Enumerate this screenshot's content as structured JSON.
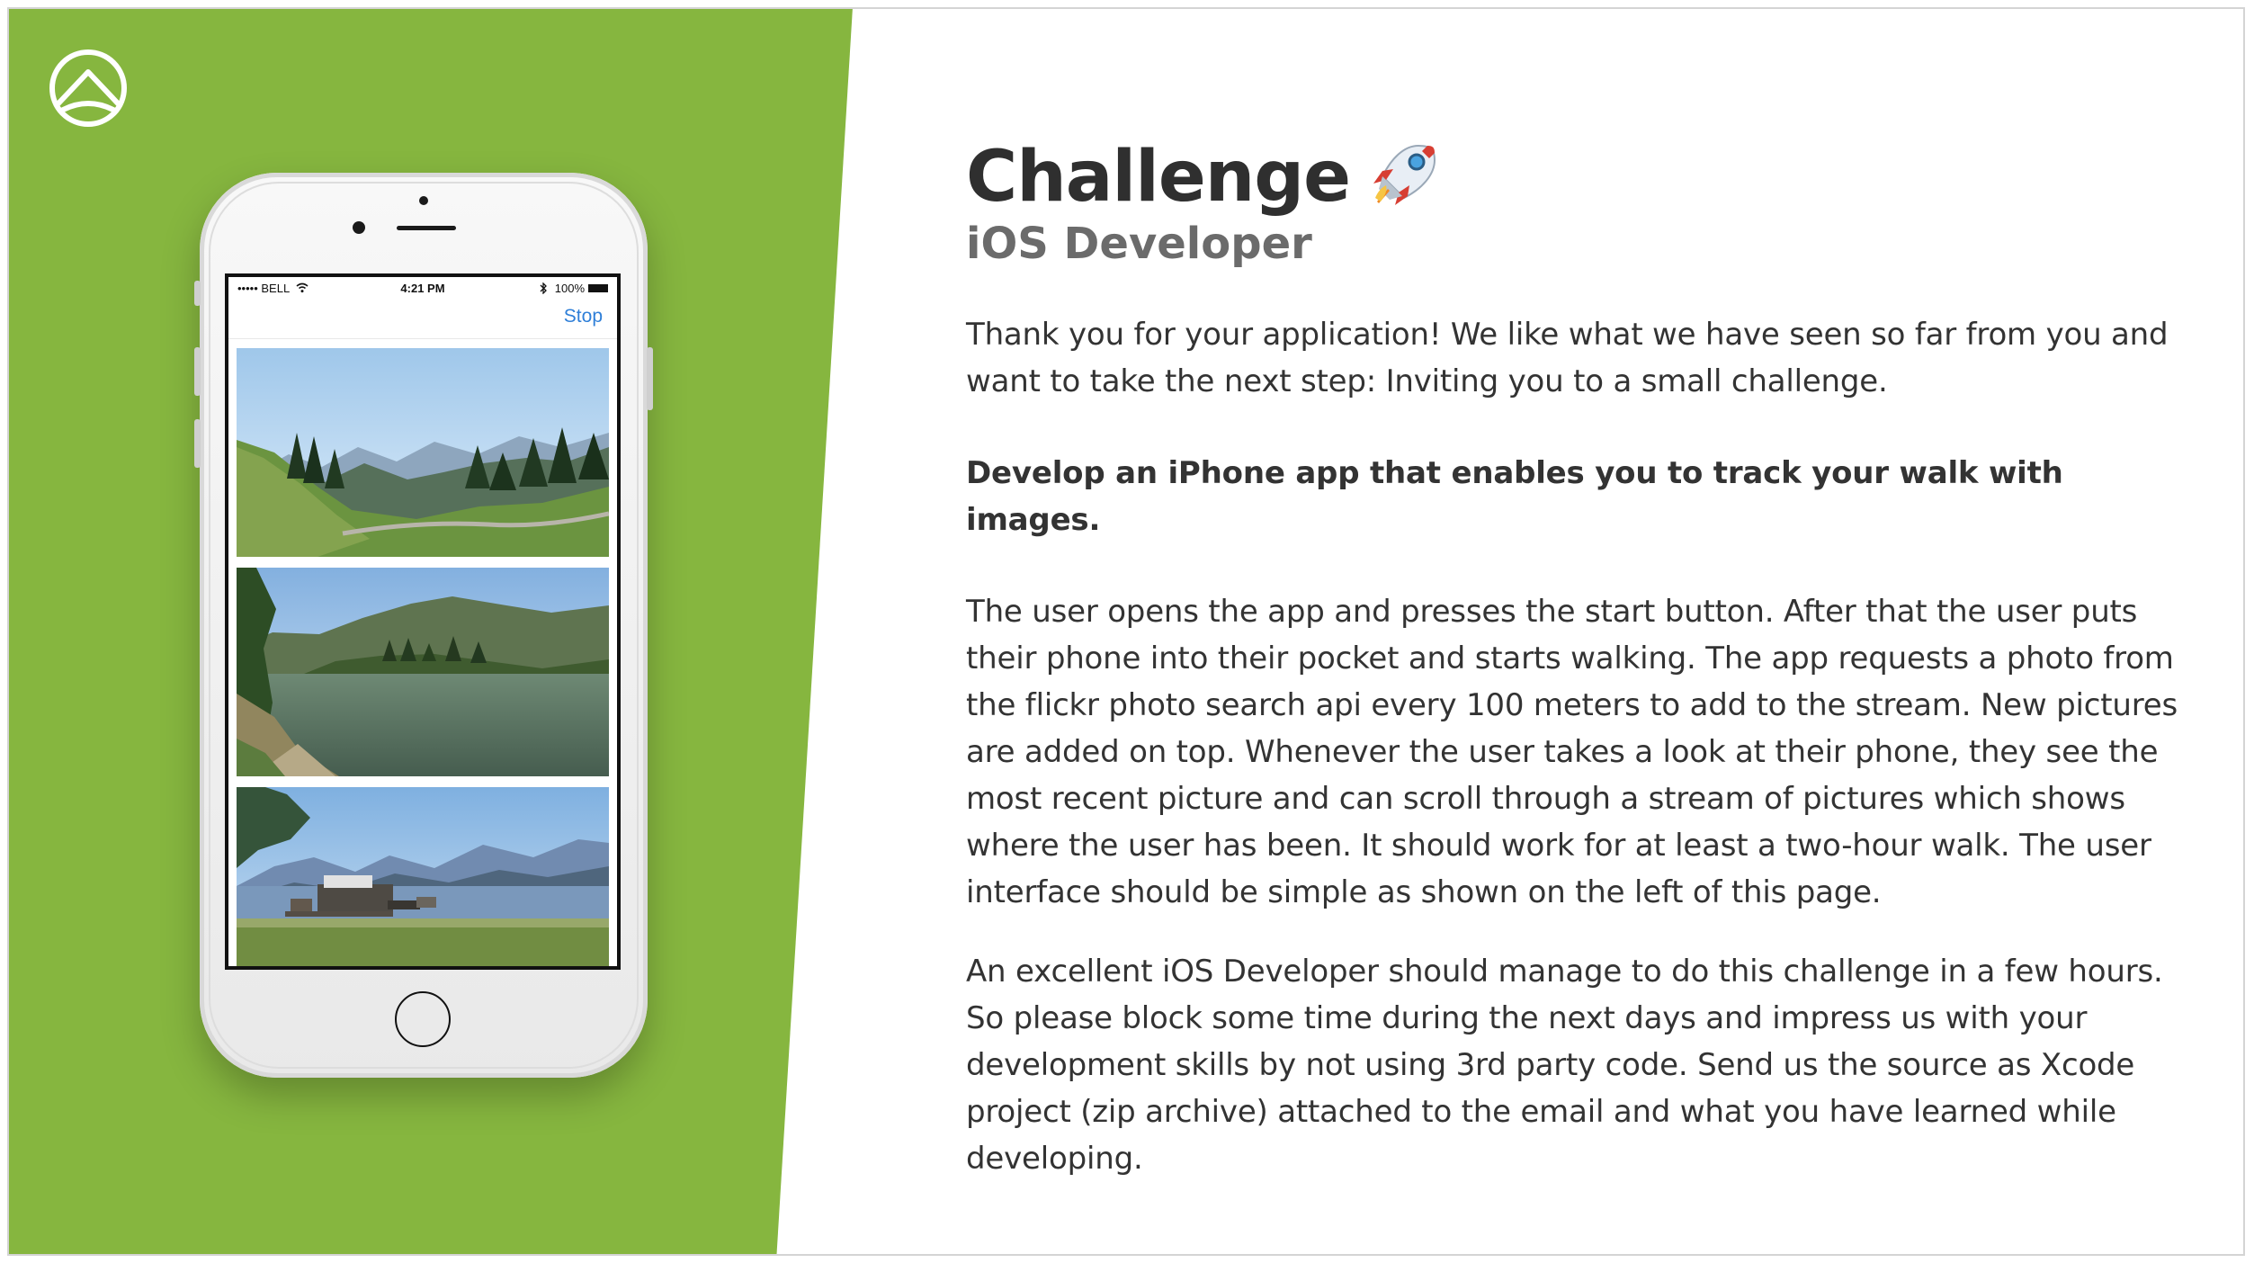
{
  "phone": {
    "status": {
      "carrier": "••••• BELL",
      "time": "4:21 PM",
      "battery": "100%"
    },
    "nav": {
      "stop_label": "Stop"
    }
  },
  "content": {
    "title": "Challenge",
    "subtitle": "iOS Developer",
    "paragraphs": [
      "Thank you for your application! We like what we have seen so far from you and want to take the next step: Inviting you to a small challenge.",
      "Develop an iPhone app that enables you to track your walk with images.",
      "The user opens the app and presses the start button. After that the user puts their phone into their pocket and starts walking. The app requests a photo from the flickr photo search api every 100 meters to add to the stream. New pictures are added on top. Whenever the user takes a look at their phone, they see the most recent picture and can scroll through a stream of pictures which shows where the user has been. It should work for at least a two-hour walk. The user interface should be simple as shown on the left of this page.",
      "An excellent iOS Developer should manage to do this challenge in a few hours. So please block some time during the next days and impress us with your development skills by not using 3rd party code. Send us the source as Xcode project (zip archive) attached to the email and what you have learned while developing."
    ]
  },
  "colors": {
    "green_panel": "#86b63f",
    "ios_blue": "#2f7fd8",
    "title": "#2f2f2f",
    "subtitle": "#6b6b6b",
    "body": "#333333"
  },
  "icons": {
    "logo": "mountain-logo-icon",
    "rocket": "rocket-icon",
    "wifi": "wifi-icon",
    "bluetooth": "bluetooth-icon",
    "battery": "battery-icon"
  }
}
